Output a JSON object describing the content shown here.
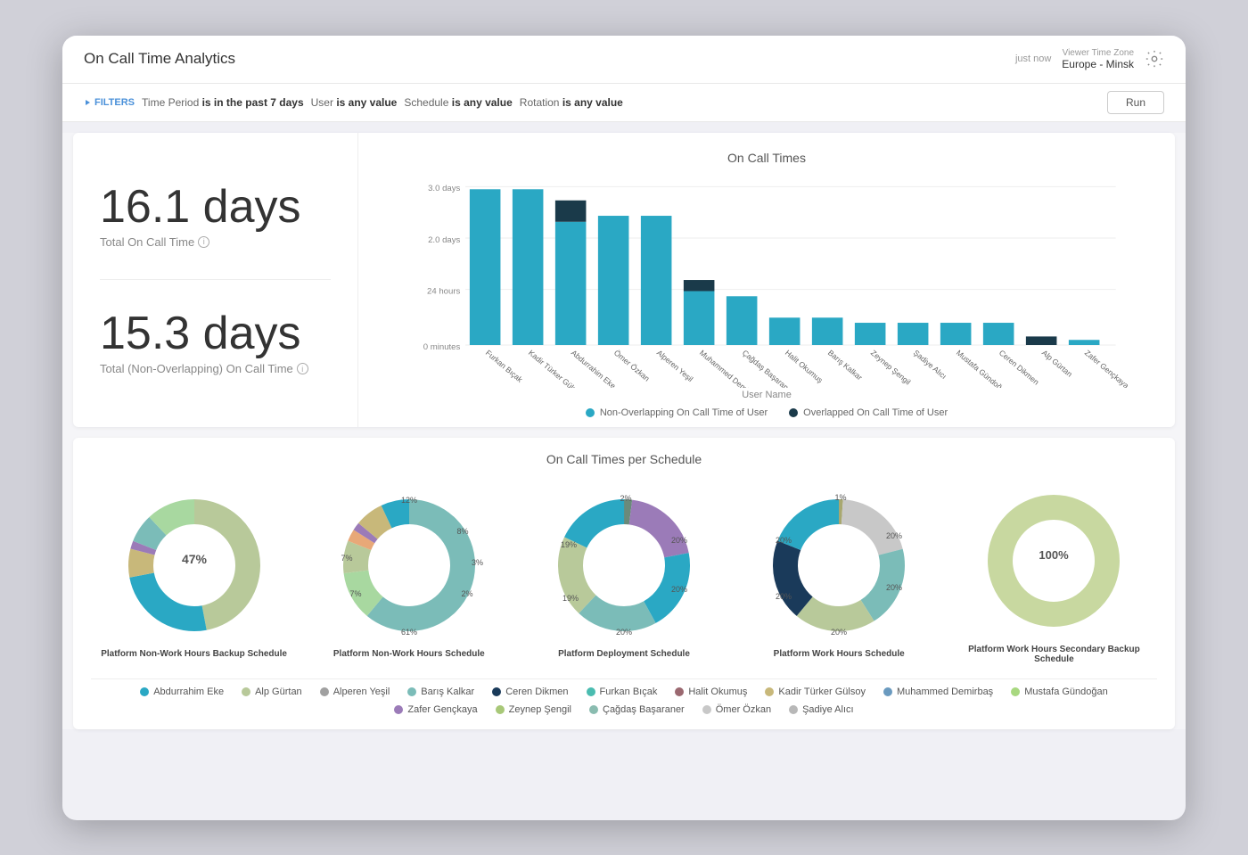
{
  "header": {
    "title": "On Call Time Analytics",
    "time": "just now",
    "timezone_label": "Viewer Time Zone",
    "timezone_value": "Europe - Minsk"
  },
  "filters": {
    "label": "FILTERS",
    "items": [
      {
        "key": "Time Period",
        "value": "is in the past 7 days"
      },
      {
        "key": "User",
        "value": "is any value"
      },
      {
        "key": "Schedule",
        "value": "is any value"
      },
      {
        "key": "Rotation",
        "value": "is any value"
      }
    ],
    "run_button": "Run"
  },
  "metrics": [
    {
      "value": "16.1 days",
      "label": "Total On Call Time"
    },
    {
      "value": "15.3 days",
      "label": "Total (Non-Overlapping) On Call Time"
    }
  ],
  "bar_chart": {
    "title": "On Call Times",
    "x_axis_label": "User Name",
    "legend": [
      {
        "label": "Non-Overlapping On Call Time of User",
        "color": "#2aa8c4"
      },
      {
        "label": "Overlapped On Call Time of User",
        "color": "#1a3a4a"
      }
    ],
    "bars": [
      {
        "name": "Furkan Bıçak",
        "non_overlap": 2.9,
        "overlap": 0
      },
      {
        "name": "Kadir Türker Gülsoy",
        "non_overlap": 2.9,
        "overlap": 0
      },
      {
        "name": "Abdurrahim Eke",
        "non_overlap": 2.3,
        "overlap": 0.4
      },
      {
        "name": "Ömer Özkan",
        "non_overlap": 2.4,
        "overlap": 0
      },
      {
        "name": "Alperen Yeşil",
        "non_overlap": 2.4,
        "overlap": 0
      },
      {
        "name": "Muhammed Demirbaş",
        "non_overlap": 1.0,
        "overlap": 0.2
      },
      {
        "name": "Çağdaş Başaraner",
        "non_overlap": 0.9,
        "overlap": 0
      },
      {
        "name": "Halit Okumuş",
        "non_overlap": 0.5,
        "overlap": 0
      },
      {
        "name": "Barış Kalkar",
        "non_overlap": 0.5,
        "overlap": 0
      },
      {
        "name": "Zeynep Şengil",
        "non_overlap": 0.4,
        "overlap": 0
      },
      {
        "name": "Şadiye Alıcı",
        "non_overlap": 0.4,
        "overlap": 0
      },
      {
        "name": "Mustafa Gündoğan",
        "non_overlap": 0.4,
        "overlap": 0
      },
      {
        "name": "Ceren Dikmen",
        "non_overlap": 0.4,
        "overlap": 0
      },
      {
        "name": "Alp Gürtan",
        "non_overlap": 0.15,
        "overlap": 0
      },
      {
        "name": "Zafer Gençkaya",
        "non_overlap": 0.1,
        "overlap": 0
      }
    ]
  },
  "donut_section": {
    "title": "On Call Times per Schedule",
    "donuts": [
      {
        "label": "Platform Non-Work Hours Backup Schedule",
        "segments": [
          {
            "pct": 47,
            "color": "#b8c99a"
          },
          {
            "pct": 25,
            "color": "#2aa8c4"
          },
          {
            "pct": 7,
            "color": "#7bbcb8"
          },
          {
            "pct": 2,
            "color": "#9b7bb8"
          },
          {
            "pct": 7,
            "color": "#c8b87a"
          },
          {
            "pct": 12,
            "color": "#a8d8a0"
          }
        ],
        "center_label": "47%"
      },
      {
        "label": "Platform Non-Work Hours Schedule",
        "segments": [
          {
            "pct": 61,
            "color": "#7bbcb8"
          },
          {
            "pct": 12,
            "color": "#a8d8a0"
          },
          {
            "pct": 8,
            "color": "#b8c99a"
          },
          {
            "pct": 3,
            "color": "#e8a878"
          },
          {
            "pct": 2,
            "color": "#9b7bb8"
          },
          {
            "pct": 7,
            "color": "#c8b87a"
          },
          {
            "pct": 7,
            "color": "#2aa8c4"
          }
        ],
        "center_label": ""
      },
      {
        "label": "Platform Deployment Schedule",
        "segments": [
          {
            "pct": 20,
            "color": "#2aa8c4"
          },
          {
            "pct": 20,
            "color": "#b8c99a"
          },
          {
            "pct": 20,
            "color": "#7bbcb8"
          },
          {
            "pct": 19,
            "color": "#2aa8c4"
          },
          {
            "pct": 19,
            "color": "#9b7bb8"
          },
          {
            "pct": 2,
            "color": "#6a8a7a"
          }
        ],
        "center_label": ""
      },
      {
        "label": "Platform Work Hours Schedule",
        "segments": [
          {
            "pct": 20,
            "color": "#2aa8c4"
          },
          {
            "pct": 20,
            "color": "#1a3a5a"
          },
          {
            "pct": 20,
            "color": "#b8c99a"
          },
          {
            "pct": 20,
            "color": "#7bbcb8"
          },
          {
            "pct": 19,
            "color": "#c8c8c8"
          },
          {
            "pct": 1,
            "color": "#a8a870"
          }
        ],
        "center_label": ""
      },
      {
        "label": "Platform Work Hours Secondary Backup Schedule",
        "segments": [
          {
            "pct": 100,
            "color": "#c8d8a0"
          }
        ],
        "center_label": "100%"
      }
    ],
    "legend": [
      {
        "label": "Abdurrahim Eke",
        "color": "#2aa8c4"
      },
      {
        "label": "Alp Gürtan",
        "color": "#b8c99a"
      },
      {
        "label": "Alperen Yeşil",
        "color": "#a0a0a0"
      },
      {
        "label": "Barış Kalkar",
        "color": "#7bbcb8"
      },
      {
        "label": "Ceren Dikmen",
        "color": "#1a3a5a"
      },
      {
        "label": "Furkan Bıçak",
        "color": "#4abcb0"
      },
      {
        "label": "Halit Okumuş",
        "color": "#9b6870"
      },
      {
        "label": "Kadir Türker Gülsoy",
        "color": "#c8b87a"
      },
      {
        "label": "Muhammed Demirbaş",
        "color": "#6a9abf"
      },
      {
        "label": "Mustafa Gündoğan",
        "color": "#a8d880"
      },
      {
        "label": "Zafer Gençkaya",
        "color": "#9b7bb8"
      },
      {
        "label": "Zeynep Şengil",
        "color": "#a8c878"
      },
      {
        "label": "Çağdaş Başaraner",
        "color": "#8abcb0"
      },
      {
        "label": "Ömer Özkan",
        "color": "#c8c8c8"
      },
      {
        "label": "Şadiye Alıcı",
        "color": "#b8b8b8"
      }
    ]
  }
}
